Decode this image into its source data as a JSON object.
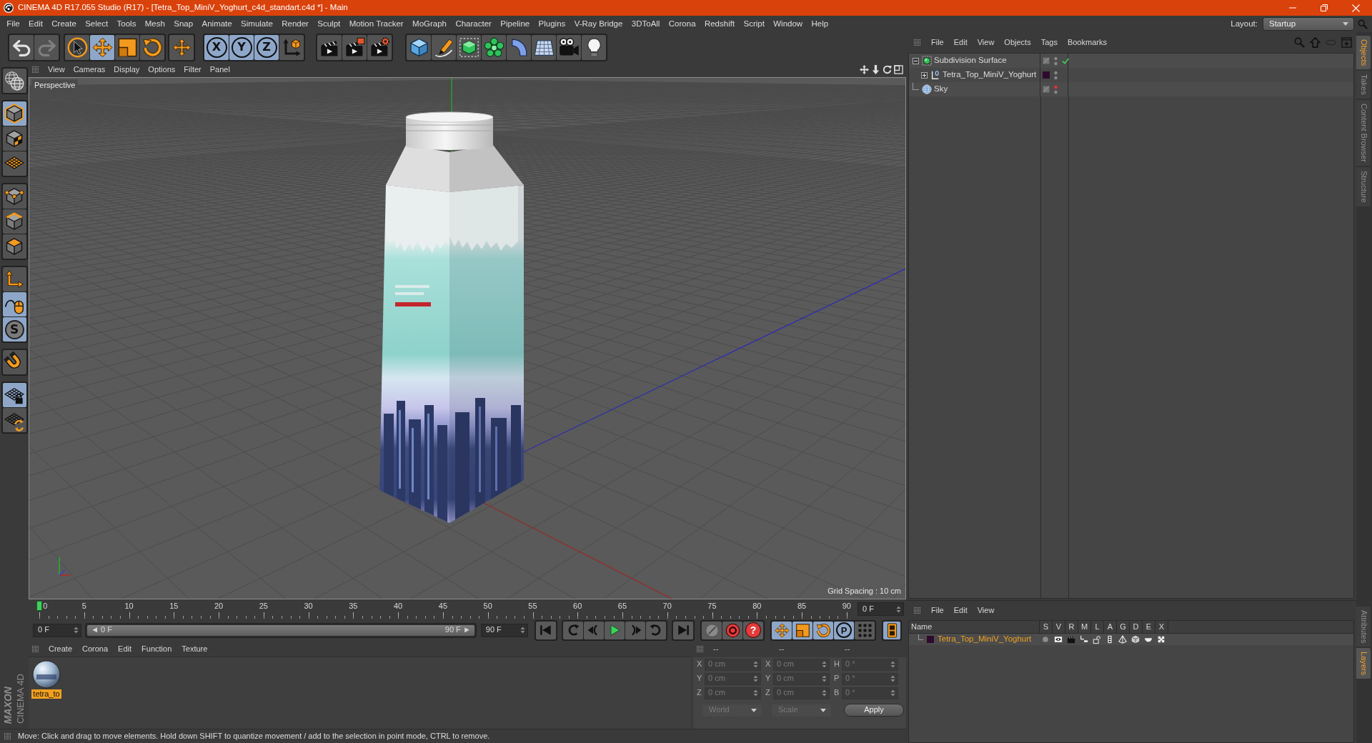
{
  "window": {
    "title": "CINEMA 4D R17.055 Studio (R17) - [Tetra_Top_MiniV_Yoghurt_c4d_standart.c4d *] - Main"
  },
  "menu_bar": {
    "items": [
      "File",
      "Edit",
      "Create",
      "Select",
      "Tools",
      "Mesh",
      "Snap",
      "Animate",
      "Simulate",
      "Render",
      "Sculpt",
      "Motion Tracker",
      "MoGraph",
      "Character",
      "Pipeline",
      "Plugins",
      "V-Ray Bridge",
      "3DToAll",
      "Corona",
      "Redshift",
      "Script",
      "Window",
      "Help"
    ],
    "layout": {
      "label": "Layout:",
      "value": "Startup"
    }
  },
  "toolbar": {
    "groups": [
      [
        {
          "kind": "undo",
          "selected": false,
          "disabled": false
        },
        {
          "kind": "redo",
          "selected": false,
          "disabled": true
        }
      ],
      [
        {
          "kind": "select",
          "selected": false,
          "disabled": false
        },
        {
          "kind": "move",
          "selected": true,
          "disabled": false
        },
        {
          "kind": "scale",
          "selected": false,
          "disabled": false
        },
        {
          "kind": "rotate",
          "selected": false,
          "disabled": false
        }
      ],
      [
        {
          "kind": "transform",
          "selected": false,
          "disabled": false
        }
      ],
      [
        {
          "kind": "axis-lock",
          "label": "X",
          "selected": true,
          "disabled": false
        },
        {
          "kind": "axis-lock",
          "label": "Y",
          "selected": true,
          "disabled": false
        },
        {
          "kind": "axis-lock",
          "label": "Z",
          "selected": true,
          "disabled": false
        },
        {
          "kind": "coordinate-system",
          "selected": false,
          "disabled": false
        }
      ],
      [
        {
          "kind": "render-view",
          "selected": false,
          "disabled": false
        },
        {
          "kind": "render-picture",
          "selected": false,
          "disabled": false
        },
        {
          "kind": "render-settings",
          "selected": false,
          "disabled": false
        }
      ],
      [
        {
          "kind": "cube",
          "selected": false,
          "disabled": false
        },
        {
          "kind": "pen",
          "selected": false,
          "disabled": false
        },
        {
          "kind": "subdivision",
          "selected": false,
          "disabled": false
        },
        {
          "kind": "cloner",
          "selected": false,
          "disabled": false
        },
        {
          "kind": "deformer",
          "selected": false,
          "disabled": false
        },
        {
          "kind": "floor",
          "selected": false,
          "disabled": false
        },
        {
          "kind": "camera",
          "selected": false,
          "disabled": false
        },
        {
          "kind": "light",
          "selected": false,
          "disabled": false
        }
      ]
    ]
  },
  "left_toolbar": {
    "groups": [
      [
        {
          "kind": "make-editable",
          "selected": false
        }
      ],
      [
        {
          "kind": "model",
          "selected": true
        },
        {
          "kind": "texture",
          "selected": false
        },
        {
          "kind": "workplane",
          "selected": false
        }
      ],
      [
        {
          "kind": "points",
          "selected": false
        },
        {
          "kind": "edges",
          "selected": false
        },
        {
          "kind": "polygons",
          "selected": false
        }
      ],
      [
        {
          "kind": "axis",
          "selected": false
        },
        {
          "kind": "tweak",
          "selected": true
        },
        {
          "kind": "soft-selection",
          "label": "S",
          "selected": true
        }
      ],
      [
        {
          "kind": "snap",
          "selected": false
        }
      ],
      [
        {
          "kind": "workplane-lock",
          "selected": true
        },
        {
          "kind": "workplane-align",
          "selected": false
        }
      ]
    ]
  },
  "logo": {
    "brand": "MAXON",
    "product": "CINEMA 4D"
  },
  "viewport": {
    "menu": [
      "View",
      "Cameras",
      "Display",
      "Options",
      "Filter",
      "Panel"
    ],
    "camera": "Perspective",
    "grid_spacing": "Grid Spacing : 10 cm"
  },
  "timeline": {
    "ticks": [
      "0",
      "5",
      "10",
      "15",
      "20",
      "25",
      "30",
      "35",
      "40",
      "45",
      "50",
      "55",
      "60",
      "65",
      "70",
      "75",
      "80",
      "85",
      "90"
    ],
    "current_frame": "0 F"
  },
  "playback": {
    "start": "0 F",
    "range": {
      "start": "◄ 0 F",
      "end": "90 F ►",
      "level": 1
    },
    "end": "90 F",
    "transport": [
      [
        {
          "kind": "first"
        }
      ],
      [
        {
          "kind": "prev-key"
        },
        {
          "kind": "prev-frame"
        },
        {
          "kind": "play"
        },
        {
          "kind": "next-frame"
        },
        {
          "kind": "next-key"
        }
      ],
      [
        {
          "kind": "last"
        }
      ]
    ],
    "keys": [
      [
        {
          "kind": "autokey",
          "selected": false
        },
        {
          "kind": "record",
          "selected": false
        },
        {
          "kind": "key-help",
          "label": "?",
          "selected": false
        }
      ],
      [
        {
          "kind": "key-move",
          "selected": true
        },
        {
          "kind": "key-scale",
          "selected": true
        },
        {
          "kind": "key-rotate",
          "selected": true
        },
        {
          "kind": "key-param",
          "label": "P",
          "selected": true
        },
        {
          "kind": "key-pla",
          "selected": false
        }
      ],
      [
        {
          "kind": "timeline",
          "selected": true
        }
      ]
    ]
  },
  "materials": {
    "menu": [
      "Create",
      "Corona",
      "Edit",
      "Function",
      "Texture"
    ],
    "items": [
      {
        "name": "tetra_to",
        "selected": true
      }
    ]
  },
  "coordinates": {
    "headers": [
      "--",
      "--",
      "--"
    ],
    "disabled": true,
    "rows": [
      {
        "axis": "X",
        "position": "0 cm",
        "size_axis": "X",
        "size": "0 cm",
        "rotation_axis": "H",
        "rotation": "0 °"
      },
      {
        "axis": "Y",
        "position": "0 cm",
        "size_axis": "Y",
        "size": "0 cm",
        "rotation_axis": "P",
        "rotation": "0 °"
      },
      {
        "axis": "Z",
        "position": "0 cm",
        "size_axis": "Z",
        "size": "0 cm",
        "rotation_axis": "B",
        "rotation": "0 °"
      }
    ],
    "mode": "World",
    "size_mode": "Scale",
    "apply": "Apply"
  },
  "status_bar": {
    "text": "Move: Click and drag to move elements. Hold down SHIFT to quantize movement / add to the selection in point mode, CTRL to remove."
  },
  "objects": {
    "menu": [
      "File",
      "Edit",
      "View",
      "Objects",
      "Tags",
      "Bookmarks"
    ],
    "items": [
      {
        "name": "Subdivision Surface",
        "kind": "subdivision",
        "expanded": true,
        "enabled": true,
        "editor_visible": true,
        "render_visible": true,
        "children": [
          {
            "name": "Tetra_Top_MiniV_Yoghurt",
            "kind": "null",
            "expanded": false,
            "color": "#2e0b2c",
            "editor_visible": true,
            "render_visible": true
          }
        ]
      },
      {
        "name": "Sky",
        "kind": "sky",
        "editor_visible": false,
        "render_visible": true
      }
    ]
  },
  "layers": {
    "menu": [
      "File",
      "Edit",
      "View"
    ],
    "columns": [
      "Name",
      "S",
      "V",
      "R",
      "M",
      "L",
      "A",
      "G",
      "D",
      "E",
      "X"
    ],
    "items": [
      {
        "name": "Tetra_Top_MiniV_Yoghurt",
        "color": "#2e0b2c",
        "selected": true
      }
    ]
  },
  "side_tabs": {
    "top": [
      {
        "label": "Objects",
        "selected": true
      },
      {
        "label": "Takes",
        "selected": false
      },
      {
        "label": "Content Browser",
        "selected": false
      },
      {
        "label": "Structure",
        "selected": false
      }
    ],
    "bottom": [
      {
        "label": "Attributes",
        "selected": false
      },
      {
        "label": "Layers",
        "selected": true
      }
    ]
  }
}
